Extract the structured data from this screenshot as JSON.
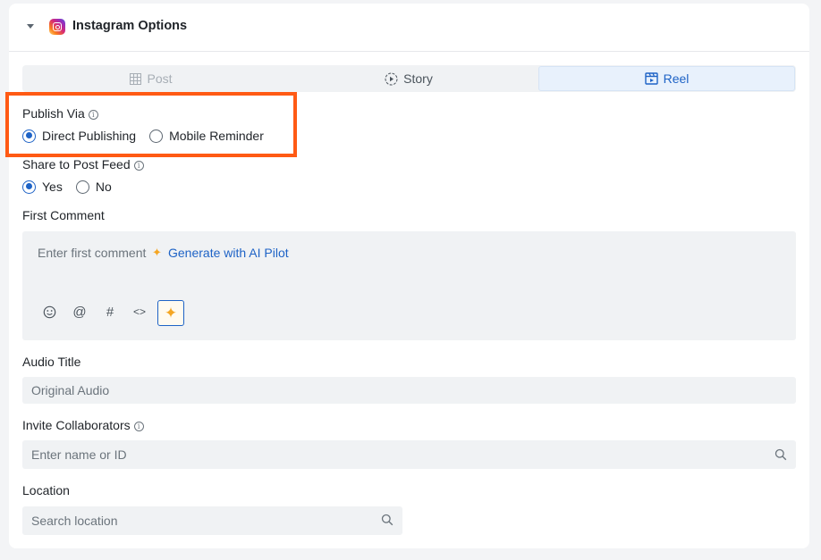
{
  "header": {
    "title": "Instagram Options"
  },
  "tabs": [
    {
      "label": "Post",
      "state": "disabled"
    },
    {
      "label": "Story",
      "state": "normal"
    },
    {
      "label": "Reel",
      "state": "selected"
    }
  ],
  "publish_via": {
    "label": "Publish Via",
    "options": [
      "Direct Publishing",
      "Mobile Reminder"
    ],
    "selected": "Direct Publishing"
  },
  "share_to_feed": {
    "label": "Share to Post Feed",
    "options": [
      "Yes",
      "No"
    ],
    "selected": "Yes"
  },
  "first_comment": {
    "label": "First Comment",
    "placeholder": "Enter first comment",
    "ai_link": "Generate with AI Pilot",
    "tools": [
      "emoji-icon",
      "mention-icon",
      "hashtag-icon",
      "code-icon",
      "ai-sparkle-icon"
    ]
  },
  "audio_title": {
    "label": "Audio Title",
    "placeholder": "Original Audio"
  },
  "collaborators": {
    "label": "Invite Collaborators",
    "placeholder": "Enter name or ID"
  },
  "location": {
    "label": "Location",
    "placeholder": "Search location"
  },
  "colors": {
    "accent": "#1e63c6",
    "highlight": "#ff5a14",
    "field_bg": "#f0f2f4"
  }
}
